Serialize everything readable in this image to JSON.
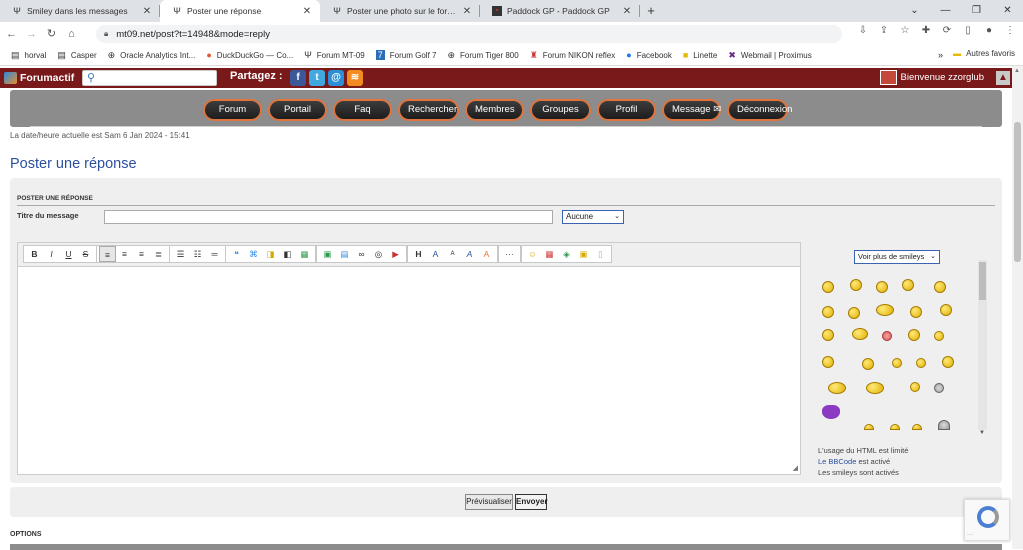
{
  "browser": {
    "tabs": [
      {
        "title": "Smiley dans les messages",
        "icon": "forumactif-y-icon",
        "active": false
      },
      {
        "title": "Poster une réponse",
        "icon": "forumactif-y-icon",
        "active": true
      },
      {
        "title": "Poster une photo sur le forum ? -",
        "icon": "forumactif-y-icon",
        "active": false
      },
      {
        "title": "Paddock GP - Paddock GP",
        "icon": "paddock-icon",
        "active": false
      }
    ],
    "url": "mt09.net/post?t=14948&mode=reply",
    "bookmarks": [
      {
        "label": "horval",
        "icon": "doc-icon"
      },
      {
        "label": "Casper",
        "icon": "doc-icon"
      },
      {
        "label": "Oracle Analytics Int...",
        "icon": "globe-icon"
      },
      {
        "label": "DuckDuckGo — Co...",
        "icon": "duckduckgo-icon"
      },
      {
        "label": "Forum MT-09",
        "icon": "forumactif-y-icon"
      },
      {
        "label": "Forum Golf 7",
        "icon": "golf7-icon"
      },
      {
        "label": "Forum Tiger 800",
        "icon": "globe-icon"
      },
      {
        "label": "Forum NIKON reflex",
        "icon": "nikon-icon"
      },
      {
        "label": "Facebook",
        "icon": "facebook-icon"
      },
      {
        "label": "Linette",
        "icon": "linette-icon"
      },
      {
        "label": "Webmail | Proximus",
        "icon": "proximus-icon"
      }
    ],
    "bookmarks_more": "»",
    "other_bookmarks": "Autres favoris"
  },
  "forum": {
    "brand": "Forumactif",
    "share_label": "Partagez :",
    "welcome": "Bienvenue zzorglub",
    "menu": [
      "Forum",
      "Portail",
      "Faq",
      "Rechercher",
      "Membres",
      "Groupes",
      "Profil",
      "Message",
      "Déconnexion"
    ],
    "datetime": "La date/heure actuelle est Sam 6 Jan 2024 - 15:41",
    "page_title": "Poster une réponse",
    "section_title": "POSTER UNE RÉPONSE",
    "title_label": "Titre du message",
    "title_value": "",
    "icon_select": "Aucune",
    "smileys_select": "Voir plus de smileys",
    "rules": {
      "html": "L'usage du HTML est limité",
      "bbcode_link": "Le BBCode",
      "bbcode_rest": " est activé",
      "smileys": "Les smileys sont activés"
    },
    "preview_button": "Prévisualiser",
    "send_button": "Envoyer",
    "options_label": "OPTIONS"
  },
  "colors": {
    "topbar": "#7a1919",
    "nav_panel": "#8c8c8c",
    "menu_button_glow": "#e0743c",
    "title_blue": "#2b4fa0"
  }
}
